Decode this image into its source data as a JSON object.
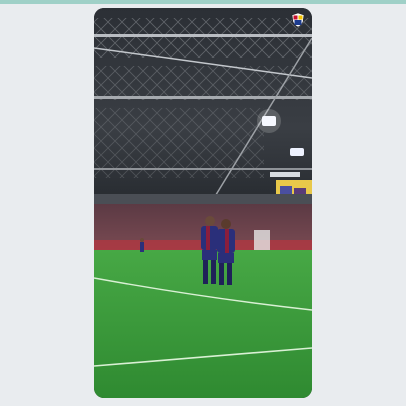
{
  "media": {
    "kind": "vertical-video-frame",
    "subject": "two-players-celebrating-on-pitch"
  },
  "overlay": {
    "badge_icon": "club-crest-icon"
  },
  "colors": {
    "page_background": "#e9ecef",
    "accent_rule": "#9fd0c7",
    "pitch_green": "#3c9a3a",
    "roof_steel": "#6b6f74",
    "kit_blue": "#2a2f7a",
    "kit_garnet": "#8a1e3c"
  }
}
